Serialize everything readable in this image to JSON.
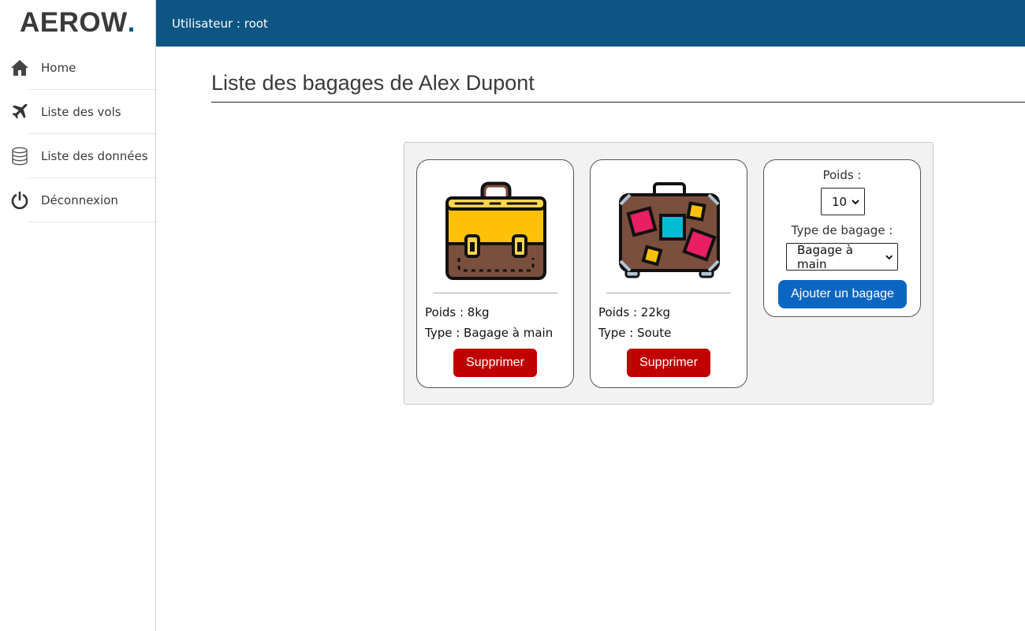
{
  "brand": {
    "name": "AEROW",
    "dot": "."
  },
  "topbar": {
    "user_label": "Utilisateur : root"
  },
  "sidebar": {
    "items": [
      {
        "label": "Home",
        "icon": "home-icon"
      },
      {
        "label": "Liste des vols",
        "icon": "plane-icon"
      },
      {
        "label": "Liste des données",
        "icon": "database-icon"
      },
      {
        "label": "Déconnexion",
        "icon": "power-icon"
      }
    ]
  },
  "main": {
    "title": "Liste des bagages de Alex Dupont",
    "bags": [
      {
        "weight": "Poids : 8kg",
        "type": "Type : Bagage à main",
        "delete_label": "Supprimer",
        "image": "briefcase-icon"
      },
      {
        "weight": "Poids : 22kg",
        "type": "Type : Soute",
        "delete_label": "Supprimer",
        "image": "suitcase-icon"
      }
    ],
    "form": {
      "weight_label": "Poids :",
      "weight_value": "10",
      "type_label": "Type de bagage :",
      "type_value": "Bagage à main",
      "add_label": "Ajouter un bagage"
    }
  },
  "colors": {
    "topbar": "#0d5582",
    "delete": "#c00000",
    "add": "#0a66c2",
    "panel": "#f2f2f2"
  }
}
